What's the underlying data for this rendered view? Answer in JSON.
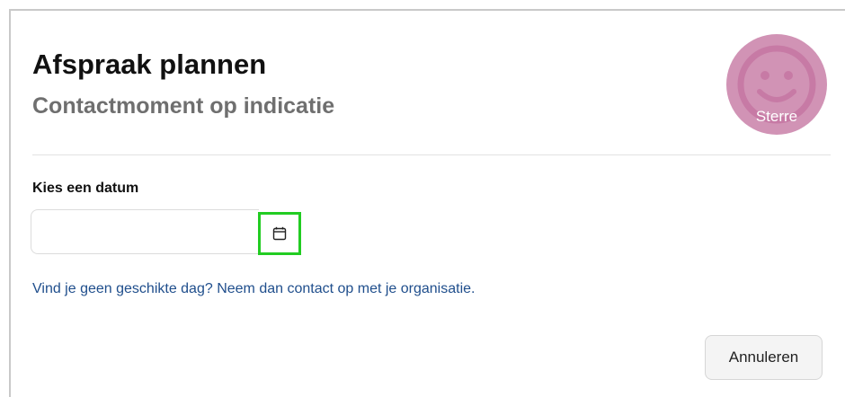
{
  "header": {
    "title": "Afspraak plannen",
    "subtitle": "Contactmoment op indicatie"
  },
  "avatar": {
    "name": "Sterre",
    "icon": "smiley-face-icon",
    "color": "#d193b5"
  },
  "date_picker": {
    "label": "Kies een datum",
    "value": "",
    "placeholder": "",
    "button_icon": "calendar-icon",
    "highlight_color": "#22cc22"
  },
  "help": {
    "link_text": "Vind je geen geschikte dag? Neem dan contact op met je organisatie.",
    "link_color": "#1f4e8c"
  },
  "actions": {
    "cancel_label": "Annuleren"
  }
}
